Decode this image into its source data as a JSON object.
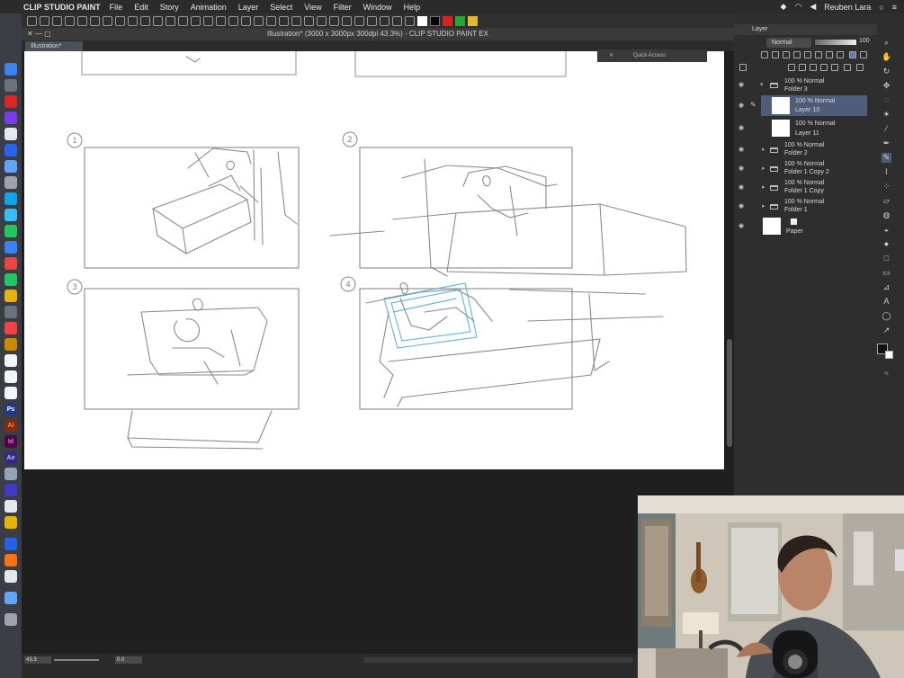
{
  "menubar": {
    "app_name": "CLIP STUDIO PAINT",
    "menus": [
      "File",
      "Edit",
      "Story",
      "Animation",
      "Layer",
      "Select",
      "View",
      "Filter",
      "Window",
      "Help"
    ],
    "user": "Reuben Lara"
  },
  "document": {
    "title": "Illustration* (3000 x 3000px 300dpi 43.3%) - CLIP STUDIO PAINT EX",
    "tab_label": "Illustration*"
  },
  "quick_access": {
    "label": "Quick Access"
  },
  "status": {
    "zoom": "43.3",
    "angle": "0.0"
  },
  "layer_panel": {
    "header": "Layer",
    "blend_mode": "Normal",
    "opacity": "100",
    "layers": [
      {
        "line1": "100 % Normal",
        "line2": "Folder 3",
        "type": "folder"
      },
      {
        "line1": "100 % Normal",
        "line2": "Layer 10",
        "type": "layer",
        "selected": true
      },
      {
        "line1": "100 % Normal",
        "line2": "Layer 11",
        "type": "layer"
      },
      {
        "line1": "100 % Normal",
        "line2": "Folder 2",
        "type": "folder"
      },
      {
        "line1": "100 % Normal",
        "line2": "Folder 1 Copy 2",
        "type": "folder"
      },
      {
        "line1": "100 % Normal",
        "line2": "Folder 1 Copy",
        "type": "folder"
      },
      {
        "line1": "100 % Normal",
        "line2": "Folder 1",
        "type": "folder"
      },
      {
        "line1": "",
        "line2": "Paper",
        "type": "paper"
      }
    ]
  },
  "tools": [
    "zoom-icon",
    "hand-icon",
    "rotate-icon",
    "move-icon",
    "lasso-icon",
    "magic-wand-icon",
    "eyedropper-icon",
    "pen-icon",
    "pencil-icon",
    "brush-icon",
    "airbrush-icon",
    "eraser-icon",
    "blend-icon",
    "fill-icon",
    "gradient-icon",
    "figure-icon",
    "frame-icon",
    "ruler-icon",
    "text-icon",
    "balloon-icon",
    "correct-line-icon",
    "color-swatch-icon"
  ],
  "panels": {
    "number_labels": [
      "1",
      "2",
      "3",
      "4"
    ]
  },
  "colors": {
    "accent_selected": "#4f5d7a",
    "sketch_blue": "#5aa9d6"
  }
}
